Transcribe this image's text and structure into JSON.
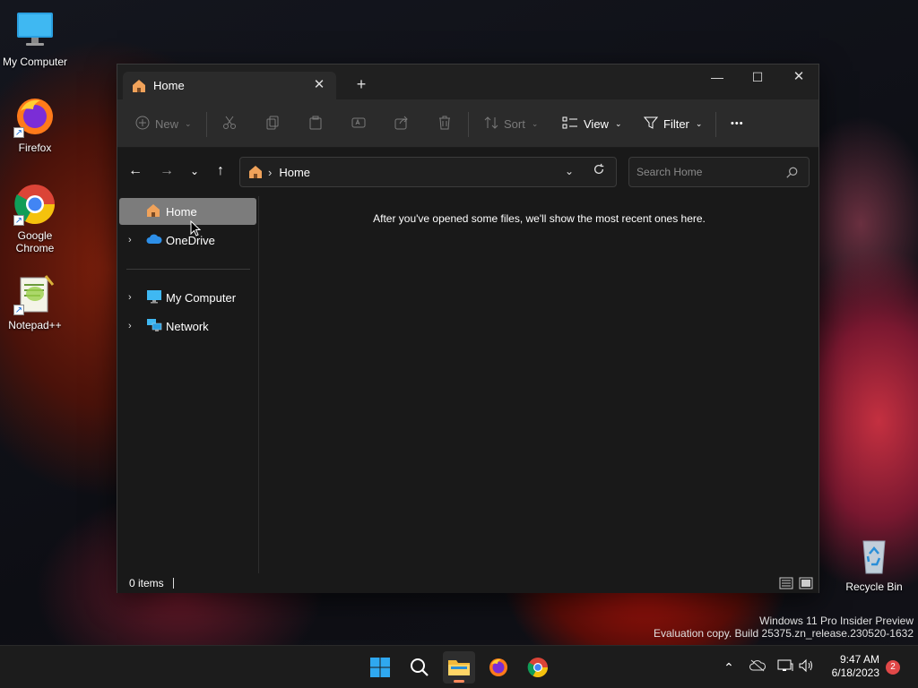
{
  "desktop": {
    "icons": [
      {
        "label": "My Computer",
        "icon": "monitor-icon"
      },
      {
        "label": "Firefox",
        "icon": "firefox-icon"
      },
      {
        "label": "Google Chrome",
        "icon": "chrome-icon"
      },
      {
        "label": "Notepad++",
        "icon": "notepadpp-icon"
      },
      {
        "label": "Recycle Bin",
        "icon": "recycle-bin-icon"
      }
    ],
    "watermark": {
      "line1": "Windows 11 Pro Insider Preview",
      "line2": "Evaluation copy. Build 25375.zn_release.230520-1632"
    }
  },
  "explorer": {
    "tab": {
      "title": "Home",
      "icon": "home-icon"
    },
    "window_controls": {
      "minimize": "—",
      "maximize": "☐",
      "close": "✕"
    },
    "toolbar": {
      "new_label": "New",
      "sort_label": "Sort",
      "view_label": "View",
      "filter_label": "Filter",
      "more_label": "•••"
    },
    "address": {
      "crumb": "Home"
    },
    "search": {
      "placeholder": "Search Home"
    },
    "sidebar": {
      "items": [
        {
          "label": "Home",
          "selected": true
        },
        {
          "label": "OneDrive"
        },
        {
          "label": "My Computer"
        },
        {
          "label": "Network"
        }
      ]
    },
    "content": {
      "empty_message": "After you've opened some files, we'll show the most recent ones here."
    },
    "status": {
      "item_count": "0 items"
    }
  },
  "taskbar": {
    "apps": [
      "start-icon",
      "search-icon",
      "file-explorer-icon",
      "firefox-icon",
      "chrome-icon"
    ],
    "clock": {
      "time": "9:47 AM",
      "date": "6/18/2023"
    },
    "notification_count": "2"
  },
  "colors": {
    "accent": "#ff8a5c",
    "selected_sidebar": "#7c7c7c",
    "window_bg": "#191919",
    "toolbar_bg": "#2b2b2b",
    "notification_badge": "#e04848"
  }
}
